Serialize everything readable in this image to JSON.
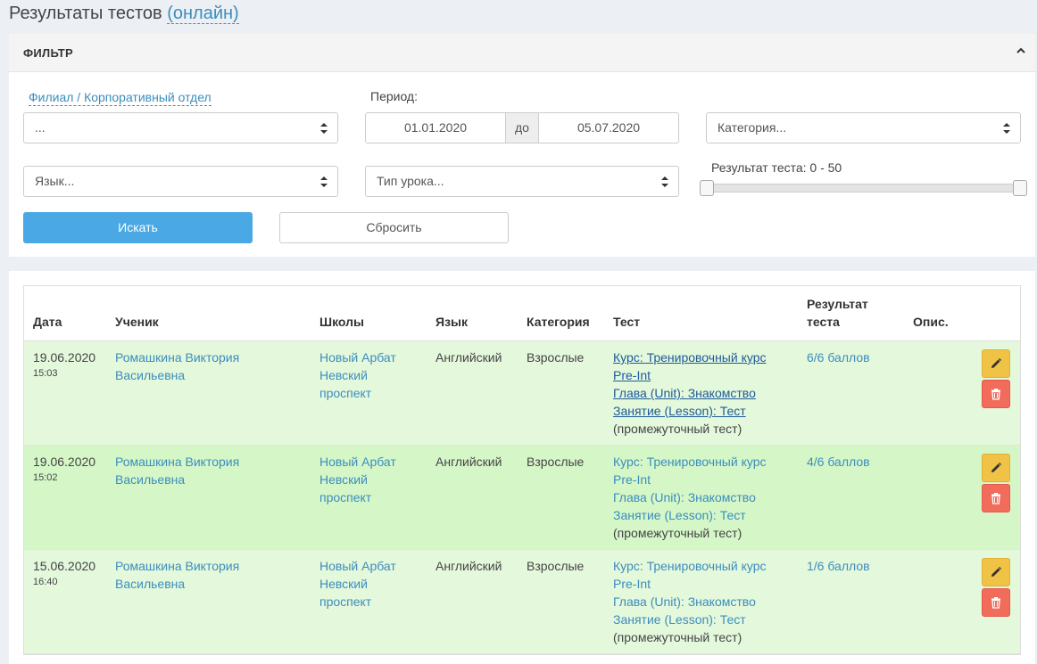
{
  "page": {
    "title": "Результаты тестов",
    "title_link": "(онлайн)"
  },
  "filter": {
    "title": "ФИЛЬТР",
    "branch_label": "Филиал / Корпоративный отдел",
    "branch_value": "...",
    "period_label": "Период:",
    "date_from": "01.01.2020",
    "date_sep": "до",
    "date_to": "05.07.2020",
    "category_placeholder": "Категория...",
    "language_placeholder": "Язык...",
    "lesson_type_placeholder": "Тип урока...",
    "result_label": "Результат теста: 0 - 50",
    "result_range": [
      0,
      50
    ],
    "search_button": "Искать",
    "reset_button": "Сбросить"
  },
  "table": {
    "headers": {
      "date": "Дата",
      "student": "Ученик",
      "schools": "Школы",
      "language": "Язык",
      "category": "Категория",
      "test": "Тест",
      "result_line1": "Результат",
      "result_line2": "теста",
      "desc": "Опис."
    },
    "rows": [
      {
        "date": "19.06.2020",
        "time": "15:03",
        "student_line1": "Ромашкина Виктория",
        "student_line2": "Васильевна",
        "school_line1": "Новый Арбат",
        "school_line2": "Невский",
        "school_line3": "проспект",
        "language": "Английский",
        "category": "Взрослые",
        "test_course_line1": "Курс: Тренировочный курс",
        "test_course_line2": "Pre-Int",
        "test_unit": "Глава (Unit): Знакомство",
        "test_lesson": "Занятие (Lesson): Тест",
        "test_type": "(промежуточный тест)",
        "result": "6/6 баллов"
      },
      {
        "date": "19.06.2020",
        "time": "15:02",
        "student_line1": "Ромашкина Виктория",
        "student_line2": "Васильевна",
        "school_line1": "Новый Арбат",
        "school_line2": "Невский",
        "school_line3": "проспект",
        "language": "Английский",
        "category": "Взрослые",
        "test_course_line1": "Курс: Тренировочный курс",
        "test_course_line2": "Pre-Int",
        "test_unit": "Глава (Unit): Знакомство",
        "test_lesson": "Занятие (Lesson): Тест",
        "test_type": "(промежуточный тест)",
        "result": "4/6 баллов"
      },
      {
        "date": "15.06.2020",
        "time": "16:40",
        "student_line1": "Ромашкина Виктория",
        "student_line2": "Васильевна",
        "school_line1": "Новый Арбат",
        "school_line2": "Невский",
        "school_line3": "проспект",
        "language": "Английский",
        "category": "Взрослые",
        "test_course_line1": "Курс: Тренировочный курс",
        "test_course_line2": "Pre-Int",
        "test_unit": "Глава (Unit): Знакомство",
        "test_lesson": "Занятие (Lesson): Тест",
        "test_type": "(промежуточный тест)",
        "result": "1/6 баллов"
      }
    ]
  },
  "colors": {
    "accent": "#3c8dbc",
    "primary_button": "#4aa8e5",
    "edit": "#f0c346",
    "delete": "#f26c5c",
    "row_highlight": "#d5f7c8",
    "row_bg": "#e4f8dc"
  },
  "icons": {
    "edit": "pencil-icon",
    "delete": "trash-icon",
    "collapse": "chevron-up-icon",
    "select_arrow": "sort-arrows-icon"
  }
}
